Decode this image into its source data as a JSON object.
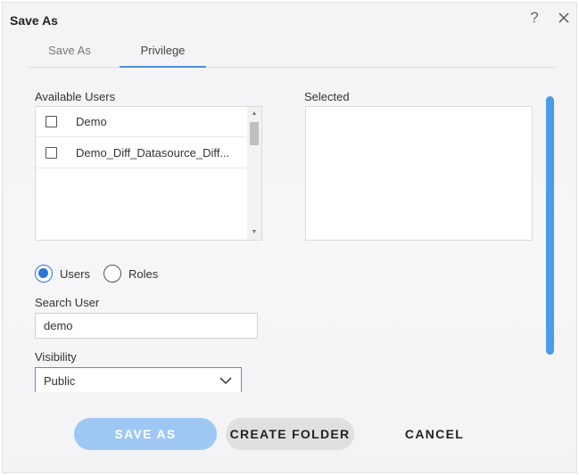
{
  "dialog": {
    "title": "Save As",
    "help_glyph": "?",
    "icons": {
      "help": "help-icon",
      "close": "close-icon"
    }
  },
  "tabs": [
    {
      "label": "Save As",
      "active": false
    },
    {
      "label": "Privilege",
      "active": true
    }
  ],
  "available_users": {
    "label": "Available Users",
    "items": [
      {
        "label": "Demo",
        "checked": false
      },
      {
        "label": "Demo_Diff_Datasource_Diff...",
        "checked": false
      }
    ]
  },
  "selected": {
    "label": "Selected",
    "items": []
  },
  "mode": {
    "options": [
      {
        "label": "Users",
        "selected": true
      },
      {
        "label": "Roles",
        "selected": false
      }
    ]
  },
  "search": {
    "label": "Search User",
    "value": "demo"
  },
  "visibility": {
    "label": "Visibility",
    "value": "Public"
  },
  "buttons": {
    "save_as": "SAVE AS",
    "create_folder": "CREATE FOLDER",
    "cancel": "CANCEL"
  },
  "colors": {
    "accent": "#2d74d6",
    "scrollbar": "#4a9be8",
    "save_button": "#9ec8f3",
    "folder_button": "#e0e0e3"
  }
}
